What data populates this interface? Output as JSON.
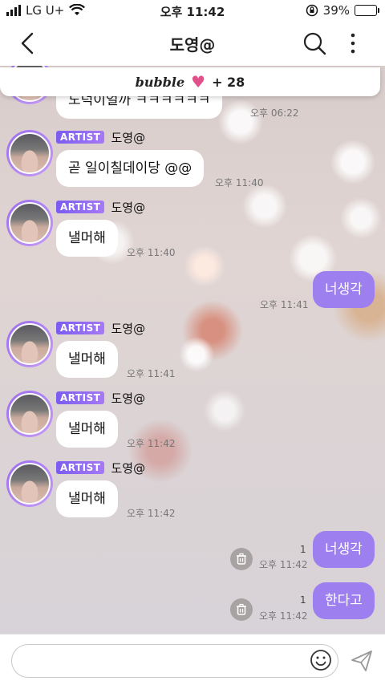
{
  "status_bar": {
    "carrier": "LG U+",
    "time": "오후 11:42",
    "battery": "39%",
    "battery_level": 0.39
  },
  "header": {
    "title": "도영@"
  },
  "bubble_bar": {
    "brand": "bubble",
    "count": "+ 28"
  },
  "sender": {
    "badge": "ARTIST",
    "name": "도영@"
  },
  "messages": [
    {
      "text": "도덕이얼까 ㅋㅋㅋㅋㅋㅋ",
      "time": "오후 06:22"
    },
    {
      "text": "곧 일이칠데이당 @@",
      "time": "오후 11:40"
    },
    {
      "text": "낼머해",
      "time": "오후 11:40"
    },
    {
      "text": "너생각",
      "time": "오후 11:41"
    },
    {
      "text": "낼머해",
      "time": "오후 11:41"
    },
    {
      "text": "낼머해",
      "time": "오후 11:42"
    },
    {
      "text": "낼머해",
      "time": "오후 11:42"
    },
    {
      "text": "너생각",
      "time": "오후 11:42",
      "read": "1"
    },
    {
      "text": "한다고",
      "time": "오후 11:42",
      "read": "1"
    }
  ],
  "input": {
    "placeholder": ""
  },
  "colors": {
    "accent": "#9d7ff0",
    "battery": "#f2c500",
    "heart": "#e0508a"
  },
  "icons": [
    "signal-icon",
    "wifi-icon",
    "rotation-lock-icon",
    "battery-icon",
    "back-icon",
    "search-icon",
    "more-icon",
    "heart-icon",
    "trash-icon",
    "emoji-icon",
    "send-icon"
  ]
}
